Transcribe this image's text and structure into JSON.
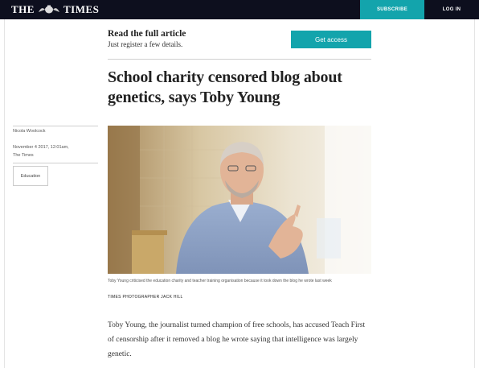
{
  "header": {
    "logo_left": "THE",
    "logo_right": "TIMES",
    "logo_icon": "crest-icon",
    "subscribe_label": "SUBSCRIBE",
    "login_label": "LOG IN",
    "accent_color": "#13a4ac",
    "bar_color": "#0d0f1e"
  },
  "promo": {
    "title": "Read the full article",
    "subtitle": "Just register a few details.",
    "button_label": "Get access"
  },
  "article": {
    "headline": "School charity censored blog about genetics, says Toby Young",
    "author": "Nicola Woolcock",
    "date": "November 4 2017, 12:01am,",
    "source": "The Times",
    "tag": "Education",
    "image_caption": "Toby Young criticised the education charity and teacher training organisation because it took down the blog he wrote last week",
    "image_credit": "TIMES PHOTOGRAPHER JACK HILL",
    "body": "Toby Young, the journalist turned champion of free schools, has accused Teach First of censorship after it removed a blog he wrote saying that intelligence was largely genetic."
  }
}
